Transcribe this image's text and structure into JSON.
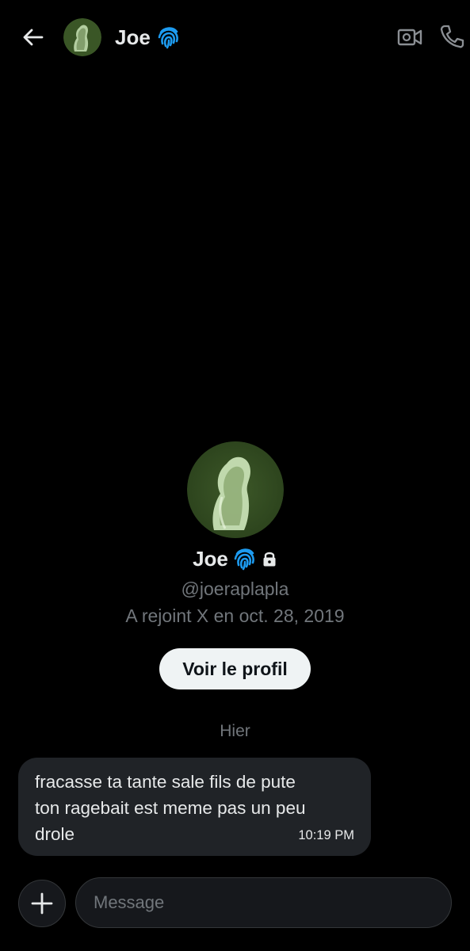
{
  "header": {
    "name": "Joe",
    "icons": {
      "back": "arrow-left-icon",
      "badge": "fingerprint-icon",
      "video": "video-camera-icon",
      "phone": "phone-icon"
    }
  },
  "profile": {
    "name": "Joe",
    "handle": "@joeraplapla",
    "joined": "A rejoint X en oct. 28, 2019",
    "view_profile_label": "Voir le profil",
    "icons": {
      "badge": "fingerprint-icon",
      "lock": "lock-icon"
    }
  },
  "conversation": {
    "day_label": "Hier",
    "messages": [
      {
        "text": "fracasse ta tante sale fils de pute\nton ragebait est meme pas un peu\ndrole",
        "time": "10:19 PM"
      }
    ]
  },
  "composer": {
    "placeholder": "Message",
    "add_icon": "plus-icon"
  },
  "colors": {
    "background": "#000000",
    "bubble": "#202327",
    "muted_text": "#71767b",
    "badge_blue": "#1d9bf0",
    "button_bg": "#eff3f4"
  }
}
